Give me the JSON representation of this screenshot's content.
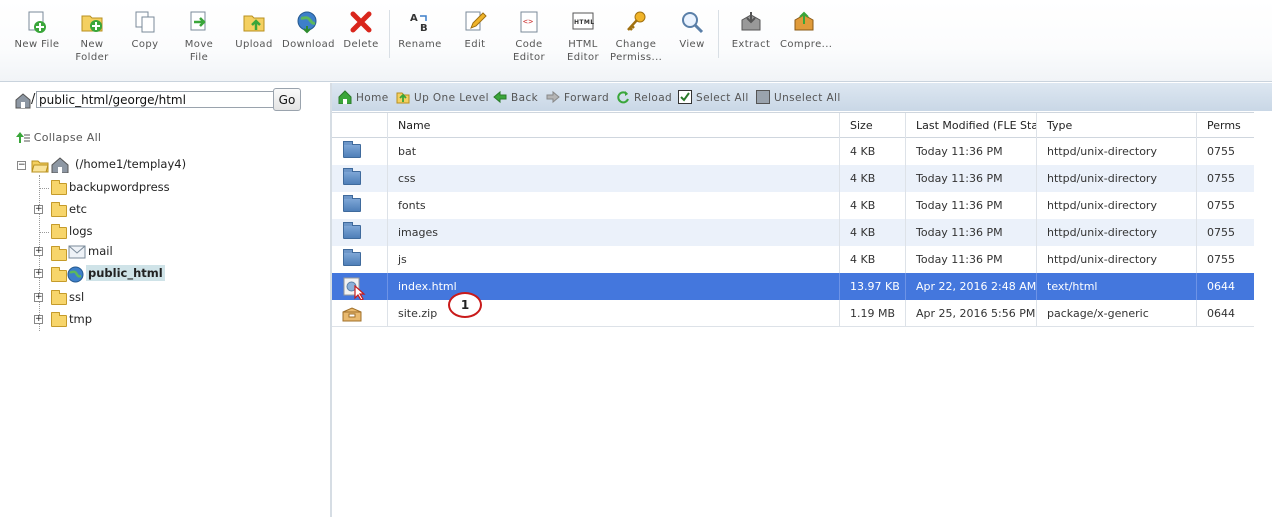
{
  "toolbar": {
    "buttons": [
      {
        "label": "New File",
        "icon": "new-file-icon"
      },
      {
        "label": "New\nFolder",
        "icon": "new-folder-icon"
      },
      {
        "label": "Copy",
        "icon": "copy-icon"
      },
      {
        "label": "Move File",
        "icon": "move-file-icon"
      },
      {
        "label": "Upload",
        "icon": "upload-icon"
      },
      {
        "label": "Download",
        "icon": "download-icon"
      },
      {
        "label": "Delete",
        "icon": "delete-icon"
      },
      {
        "label": "Rename",
        "icon": "rename-icon"
      },
      {
        "label": "Edit",
        "icon": "edit-icon"
      },
      {
        "label": "Code\nEditor",
        "icon": "code-editor-icon"
      },
      {
        "label": "HTML\nEditor",
        "icon": "html-editor-icon"
      },
      {
        "label": "Change\nPermiss...",
        "icon": "change-permissions-icon"
      },
      {
        "label": "View",
        "icon": "view-icon"
      },
      {
        "label": "Extract",
        "icon": "extract-icon"
      },
      {
        "label": "Compre...",
        "icon": "compress-icon"
      }
    ]
  },
  "left": {
    "path_value": "public_html/george/html",
    "go_label": "Go",
    "collapse_all": "Collapse All",
    "tree": {
      "root": "(/home1/templay4)",
      "children": [
        "backupwordpress",
        "etc",
        "logs",
        "mail",
        "public_html",
        "ssl",
        "tmp"
      ]
    }
  },
  "actions": {
    "home": "Home",
    "up_one_level": "Up One Level",
    "back": "Back",
    "forward": "Forward",
    "reload": "Reload",
    "select_all": "Select All",
    "unselect_all": "Unselect All"
  },
  "table": {
    "headers": {
      "name": "Name",
      "size": "Size",
      "modified": "Last Modified (FLE Stand",
      "type": "Type",
      "perms": "Perms"
    },
    "rows": [
      {
        "name": "bat",
        "size": "4 KB",
        "modified": "Today 11:36 PM",
        "type": "httpd/unix-directory",
        "perms": "0755"
      },
      {
        "name": "css",
        "size": "4 KB",
        "modified": "Today 11:36 PM",
        "type": "httpd/unix-directory",
        "perms": "0755"
      },
      {
        "name": "fonts",
        "size": "4 KB",
        "modified": "Today 11:36 PM",
        "type": "httpd/unix-directory",
        "perms": "0755"
      },
      {
        "name": "images",
        "size": "4 KB",
        "modified": "Today 11:36 PM",
        "type": "httpd/unix-directory",
        "perms": "0755"
      },
      {
        "name": "js",
        "size": "4 KB",
        "modified": "Today 11:36 PM",
        "type": "httpd/unix-directory",
        "perms": "0755"
      },
      {
        "name": "index.html",
        "size": "13.97 KB",
        "modified": "Apr 22, 2016 2:48 AM",
        "type": "text/html",
        "perms": "0644"
      },
      {
        "name": "site.zip",
        "size": "1.19 MB",
        "modified": "Apr 25, 2016 5:56 PM",
        "type": "package/x-generic",
        "perms": "0644"
      }
    ]
  },
  "callout": "1",
  "colors": {
    "selected_row": "#4477dd",
    "alt_row": "#ebf1fa",
    "callout_border": "#c91a1a"
  }
}
